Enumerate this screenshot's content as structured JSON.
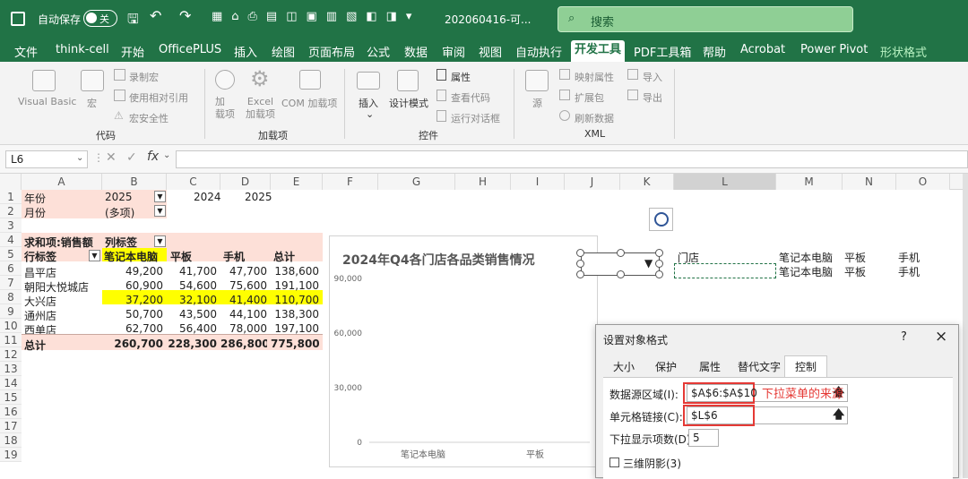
{
  "title_bar": {
    "autosave_label": "自动保存",
    "autosave_state": "关",
    "file_name": "202060416-可...",
    "search_placeholder": "搜索"
  },
  "menu": [
    "文件",
    "think-cell",
    "开始",
    "OfficePLUS",
    "插入",
    "绘图",
    "页面布局",
    "公式",
    "数据",
    "审阅",
    "视图",
    "自动执行",
    "开发工具",
    "PDF工具箱",
    "帮助",
    "Acrobat",
    "Power Pivot",
    "形状格式"
  ],
  "ribbon": {
    "code": {
      "visual_basic": "Visual Basic",
      "macro": "宏",
      "record_macro": "录制宏",
      "relative_ref": "使用相对引用",
      "macro_security": "宏安全性",
      "group": "代码"
    },
    "addins": {
      "addin": "加\n载项",
      "excel_addin": "Excel\n加载项",
      "com_addin": "COM 加载项",
      "group": "加载项"
    },
    "controls": {
      "insert": "插入",
      "design_mode": "设计模式",
      "properties": "属性",
      "view_code": "查看代码",
      "run_dialog": "运行对话框",
      "group": "控件"
    },
    "xml": {
      "source": "源",
      "map_props": "映射属性",
      "expansion": "扩展包",
      "refresh": "刷新数据",
      "import": "导入",
      "export": "导出",
      "group": "XML"
    }
  },
  "formula_bar": {
    "name_box": "L6",
    "formula": ""
  },
  "columns": [
    "A",
    "B",
    "C",
    "D",
    "E",
    "F",
    "G",
    "H",
    "I",
    "J",
    "K",
    "L",
    "M",
    "N",
    "O"
  ],
  "rows": [
    "1",
    "2",
    "3",
    "4",
    "5",
    "6",
    "7",
    "8",
    "9",
    "10",
    "11",
    "12",
    "13",
    "14",
    "15",
    "16",
    "17",
    "18",
    "19"
  ],
  "pivot": {
    "r1": {
      "a": "年份",
      "b": "2025",
      "d": "2024",
      "e": "2025"
    },
    "r2": {
      "a": "月份",
      "b": "(多项)"
    },
    "r4": {
      "a": "求和项:销售额",
      "b": "列标签"
    },
    "header": [
      "行标签",
      "笔记本电脑",
      "平板",
      "手机",
      "总计"
    ],
    "body": [
      [
        "昌平店",
        "49,200",
        "41,700",
        "47,700",
        "138,600"
      ],
      [
        "朝阳大悦城店",
        "60,900",
        "54,600",
        "75,600",
        "191,100"
      ],
      [
        "大兴店",
        "37,200",
        "32,100",
        "41,400",
        "110,700"
      ],
      [
        "通州店",
        "50,700",
        "43,500",
        "44,100",
        "138,300"
      ],
      [
        "西单店",
        "62,700",
        "56,400",
        "78,000",
        "197,100"
      ]
    ],
    "total": [
      "总计",
      "260,700",
      "228,300",
      "286,800",
      "775,800"
    ]
  },
  "side_table": {
    "r5": [
      "门店",
      "笔记本电脑",
      "平板",
      "手机"
    ],
    "r6": [
      "笔记本电脑",
      "平板",
      "手机"
    ]
  },
  "chart_data": {
    "type": "bar",
    "title": "2024年Q4各门店各品类销售情况",
    "categories": [
      "笔记本电脑",
      "平板"
    ],
    "yticks": [
      "90,000",
      "60,000",
      "30,000",
      "0"
    ],
    "ylim": [
      0,
      90000
    ]
  },
  "dialog": {
    "title": "设置对象格式",
    "help": "?",
    "close": "×",
    "tabs": [
      "大小",
      "保护",
      "属性",
      "替代文字",
      "控制"
    ],
    "source_label": "数据源区域(I):",
    "source_value": "$A$6:$A$10",
    "source_note": "下拉菜单的来源",
    "link_label": "单元格链接(C):",
    "link_value": "$L$6",
    "lines_label": "下拉显示项数(D):",
    "lines_value": "5",
    "shade_label": "三维阴影(3)"
  },
  "colors": {
    "excel_green": "#217346",
    "highlight": "#ffff00",
    "pivot_pink": "#fde0d8",
    "dialog_red": "#e53935"
  }
}
